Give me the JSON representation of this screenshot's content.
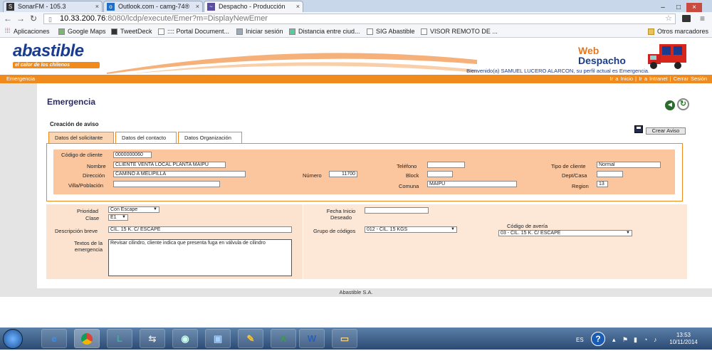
{
  "browser": {
    "tabs": [
      {
        "label": "SonarFM - 105.3",
        "icon": "S"
      },
      {
        "label": "Outlook.com - camg-74®",
        "icon": "o"
      },
      {
        "label": "Despacho - Producción",
        "icon": "~"
      }
    ],
    "url_host": "10.33.200.76",
    "url_path": ":8080/lcdp/execute/Emer?m=DisplayNewEmer",
    "bookmarks": [
      "Aplicaciones",
      "Google Maps",
      "TweetDeck",
      ":::: Portal Document...",
      "Iniciar sesión",
      "Distancia entre ciud...",
      "SIG Abastible",
      "VISOR REMOTO DE ..."
    ],
    "other_bookmarks": "Otros marcadores"
  },
  "header": {
    "logo": "abastible",
    "slogan": "el calor de los chilenos",
    "app_name_line1": "Web",
    "app_name_line2": "Despacho",
    "welcome": "Bienvenido(a) SAMUEL LUCERO ALARCON, su perfil actual es Emergencia.",
    "section": "Emergencia",
    "links": [
      "Ir a Inicio",
      "Ir a Intranet",
      "Cerrar Sesión"
    ],
    "links_sep": "|"
  },
  "page": {
    "title": "Emergencia",
    "subtitle": "Creación de aviso",
    "create_button": "Crear Aviso",
    "tabs": [
      "Datos del solicitante",
      "Datos del contacto",
      "Datos Organización"
    ]
  },
  "solicitante": {
    "codigo_cliente_label": "Código de cliente",
    "codigo_cliente": "0000000060",
    "nombre_label": "Nombre",
    "nombre": "CLIENTE VENTA LOCAL PLANTA MAIPU",
    "telefono_label": "Teléfono",
    "telefono": "",
    "tipo_cliente_label": "Tipo de cliente",
    "tipo_cliente": "Normal",
    "direccion_label": "Dirección",
    "direccion": "CAMINO A MELIPILLA",
    "numero_label": "Número",
    "numero": "11700",
    "block_label": "Block",
    "block": "",
    "dept_label": "Dept/Casa",
    "dept": "",
    "villa_label": "Villa/Población",
    "villa": "",
    "comuna_label": "Comuna",
    "comuna": "MAIPU",
    "region_label": "Region",
    "region": "13"
  },
  "aviso": {
    "prioridad_label": "Prioridad",
    "prioridad": "Con Escape",
    "clase_label": "Clase",
    "clase": "E1",
    "fecha_label": "Fecha Inicio Deseado",
    "fecha": "",
    "descripcion_label": "Descripción breve",
    "descripcion": "CIL. 15 K. C/ ESCAPE",
    "grupo_label": "Grupo de códigos",
    "grupo": "012 - CIL. 15 KGS",
    "averia_label": "Código de avería",
    "averia": "03 - CIL. 15 K. C/ ESCAPE",
    "textos_label": "Textos de la emergencia",
    "textos": "Revisar cilindro, cliente indica que presenta fuga en válvula de cilindro"
  },
  "footer": "Abastible S.A.",
  "taskbar": {
    "lang": "ES",
    "time": "13:53",
    "date": "10/11/2014"
  }
}
